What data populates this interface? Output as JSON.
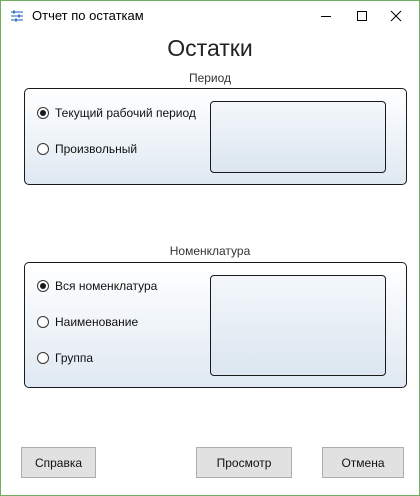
{
  "window": {
    "title": "Отчет по остаткам",
    "icon": "sliders-icon"
  },
  "heading": "Остатки",
  "period": {
    "title": "Период",
    "options": [
      {
        "label": "Текущий рабочий период",
        "checked": true
      },
      {
        "label": "Произвольный",
        "checked": false
      }
    ]
  },
  "nomenclature": {
    "title": "Номенклатура",
    "options": [
      {
        "label": "Вся номенклатура",
        "checked": true
      },
      {
        "label": "Наименование",
        "checked": false
      },
      {
        "label": "Группа",
        "checked": false
      }
    ]
  },
  "buttons": {
    "help": "Справка",
    "preview": "Просмотр",
    "cancel": "Отмена"
  },
  "colors": {
    "window_border": "#6fae5f",
    "panel_gradient_bottom": "#dfe9f2"
  }
}
